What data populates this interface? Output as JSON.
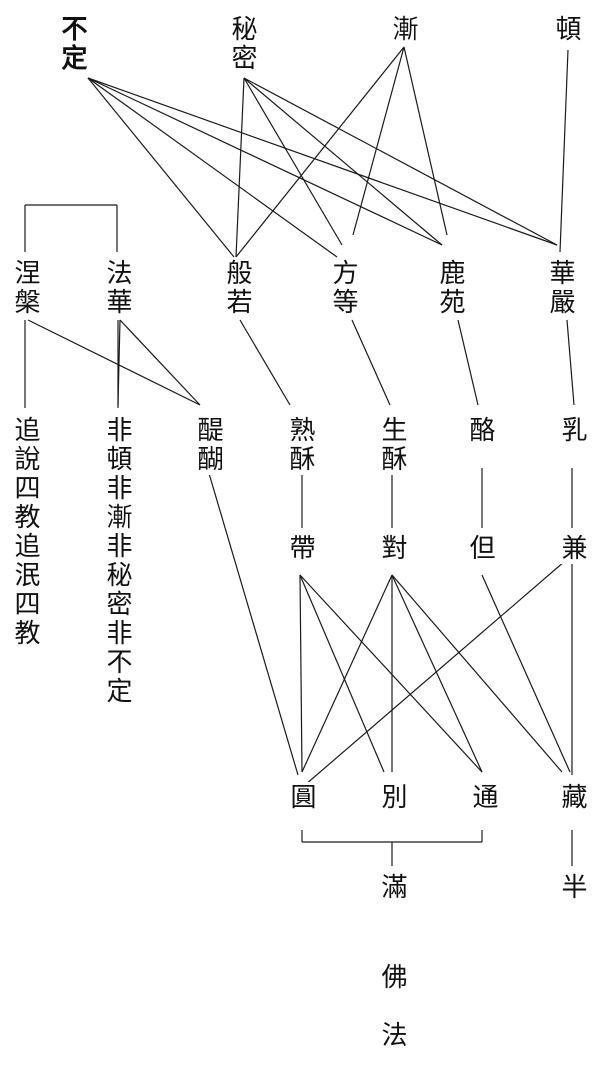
{
  "nodes": {
    "buding": "不定",
    "mimi": "秘密",
    "jian": "漸",
    "dun": "頓",
    "niepan": "涅槃",
    "fahua": "法華",
    "boruo": "般若",
    "fangdeng": "方等",
    "luyuan": "鹿苑",
    "huayan": "華嚴",
    "tihu": "醍醐",
    "shusu": "熟酥",
    "shengsu": "生酥",
    "lao": "酪",
    "ru": "乳",
    "niepan_note": "追說四教追泯四教",
    "fahua_note": "非頓非漸非秘密非不定",
    "dai": "帶",
    "dui": "對",
    "dan": "但",
    "jian2": "兼",
    "yuan": "圓",
    "bie": "別",
    "tong": "通",
    "zang": "藏",
    "man": "滿",
    "ban": "半",
    "fofa": "佛法"
  }
}
